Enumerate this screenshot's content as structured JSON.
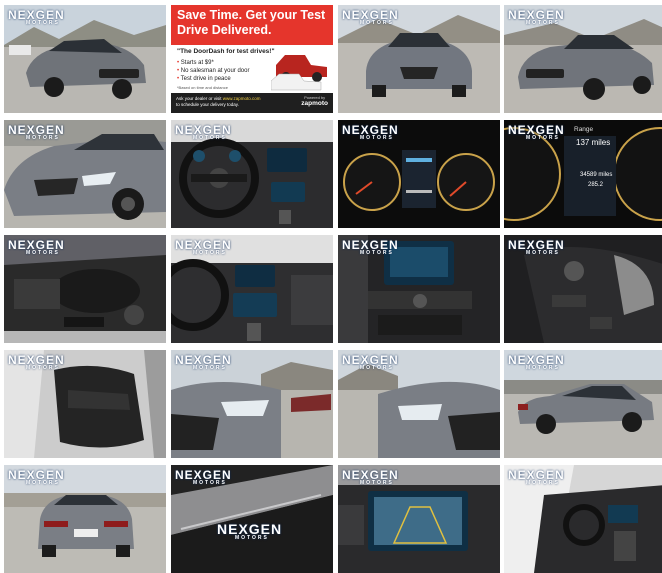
{
  "watermark": {
    "brand": "NEXGEN",
    "tagline": "MOTORS"
  },
  "ad": {
    "title": "Save Time. Get your Test Drive Delivered.",
    "tagline": "\"The DoorDash for test drives!\"",
    "bullets": [
      "Starts at $9*",
      "No salesman at your door",
      "Test drive in peace"
    ],
    "fine_print": "*Based on time and distance",
    "ask": "Ask your dealer or visit",
    "url": "www.zapmoto.com",
    "ask_end": "to schedule your delivery today.",
    "powered_by": "Powered by",
    "powered_brand": "zapmoto"
  },
  "dash": {
    "range_label": "Range",
    "range_value": "137 miles",
    "odometer": "34589 miles",
    "trip": "285.2"
  },
  "tiles": [
    {
      "name": "photo-front-three-quarter",
      "kind": "car-front-left"
    },
    {
      "name": "photo-zapmoto-ad",
      "kind": "ad"
    },
    {
      "name": "photo-front-center",
      "kind": "car-front"
    },
    {
      "name": "photo-front-right",
      "kind": "car-front-right"
    },
    {
      "name": "photo-front-closeup",
      "kind": "car-front-left"
    },
    {
      "name": "photo-steering-wheel",
      "kind": "interior-wheel"
    },
    {
      "name": "photo-gauge-cluster",
      "kind": "gauges"
    },
    {
      "name": "photo-gauge-range",
      "kind": "gauges-zoom"
    },
    {
      "name": "photo-engine-bay",
      "kind": "engine"
    },
    {
      "name": "photo-dashboard",
      "kind": "interior-wheel"
    },
    {
      "name": "photo-center-console",
      "kind": "console"
    },
    {
      "name": "photo-door-controls",
      "kind": "door"
    },
    {
      "name": "photo-front-seat",
      "kind": "seat"
    },
    {
      "name": "photo-headlight-left",
      "kind": "headlight"
    },
    {
      "name": "photo-headlight-right",
      "kind": "headlight"
    },
    {
      "name": "photo-side-rear",
      "kind": "car-side"
    },
    {
      "name": "photo-rear",
      "kind": "car-rear"
    },
    {
      "name": "photo-door-sill",
      "kind": "sill"
    },
    {
      "name": "photo-backup-camera",
      "kind": "camera"
    },
    {
      "name": "photo-interior-door-open",
      "kind": "interior-open"
    }
  ]
}
